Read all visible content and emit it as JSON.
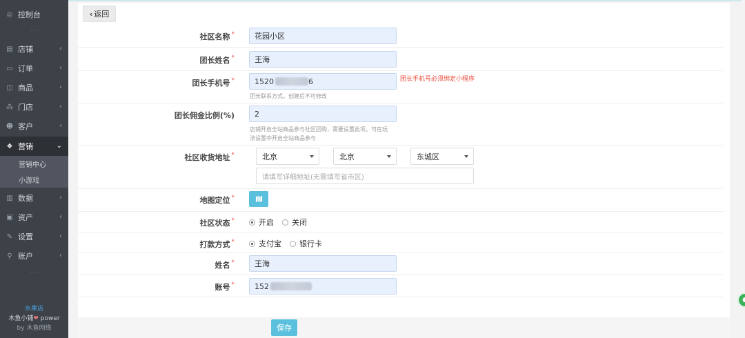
{
  "sidebar": {
    "items": [
      {
        "label": "控制台",
        "icon": "dashboard-icon"
      },
      {
        "label": "店铺",
        "icon": "shop-icon"
      },
      {
        "label": "订单",
        "icon": "order-icon"
      },
      {
        "label": "商品",
        "icon": "goods-icon"
      },
      {
        "label": "门店",
        "icon": "store-icon"
      },
      {
        "label": "客户",
        "icon": "customer-icon"
      },
      {
        "label": "营销",
        "icon": "marketing-icon"
      },
      {
        "label": "数据",
        "icon": "data-icon"
      },
      {
        "label": "资产",
        "icon": "asset-icon"
      },
      {
        "label": "设置",
        "icon": "settings-icon"
      },
      {
        "label": "账户",
        "icon": "account-icon"
      }
    ],
    "subitems": [
      "营销中心",
      "小游戏"
    ],
    "footer": {
      "shop_name": "水果店",
      "brand": "木鱼小铺",
      "power": "power",
      "by": "by 木鱼网络"
    }
  },
  "header": {
    "back_label": "返回"
  },
  "form": {
    "community_name": {
      "label": "社区名称",
      "value": "花园小区"
    },
    "leader_name": {
      "label": "团长姓名",
      "value": "王海"
    },
    "leader_phone": {
      "label": "团长手机号",
      "value_prefix": "1520",
      "value_suffix": "6",
      "help": "团长联系方式，创建后不可修改",
      "error": "团长手机号必须绑定小程序"
    },
    "commission": {
      "label": "团长佣金比例(%)",
      "value": "2",
      "help_line1": "店铺开启全站商品参与社区团购，需要设置此项。可在玩",
      "help_line2": "法设置中开启全站商品参与"
    },
    "address": {
      "label": "社区收货地址",
      "province": "北京",
      "city": "北京",
      "district": "东城区",
      "detail_placeholder": "请填写详细地址(无需填写省市区)"
    },
    "map": {
      "label": "地图定位"
    },
    "status": {
      "label": "社区状态",
      "options": [
        "开启",
        "关闭"
      ],
      "selected": "开启"
    },
    "payment": {
      "label": "打款方式",
      "options": [
        "支付宝",
        "银行卡"
      ],
      "selected": "支付宝"
    },
    "name": {
      "label": "姓名",
      "value": "王海"
    },
    "account": {
      "label": "账号",
      "value_prefix": "152"
    },
    "required_mark": "*"
  },
  "actions": {
    "save_label": "保存"
  },
  "colors": {
    "sidebar": "#3d4148",
    "accent": "#5bc0de",
    "error": "#e74c3c",
    "required": "#e84b4b"
  }
}
